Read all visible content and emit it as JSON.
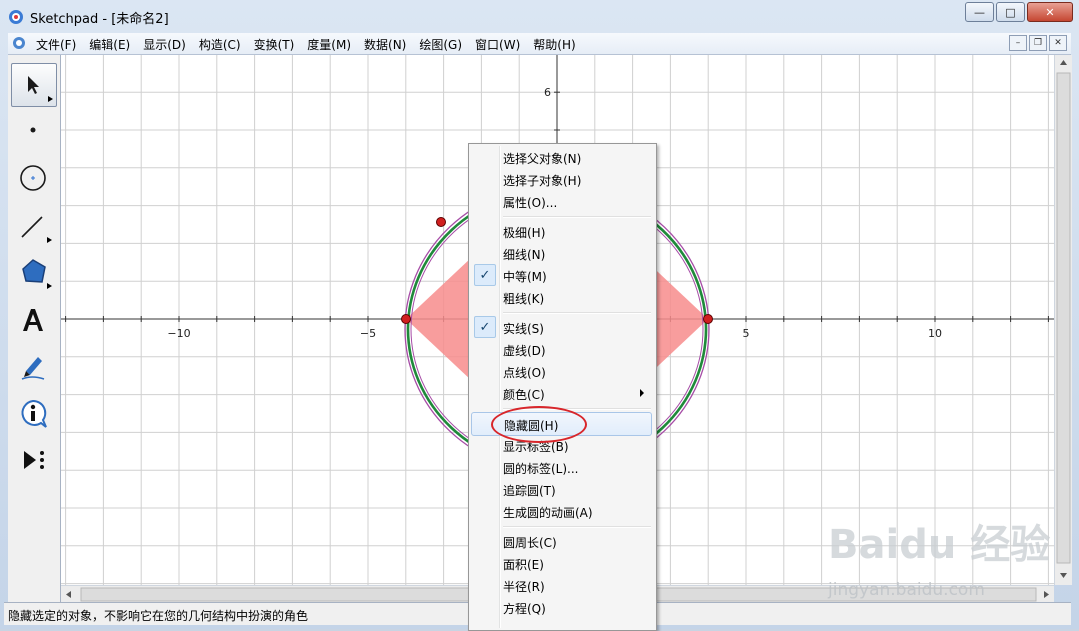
{
  "window": {
    "title": "Sketchpad - [未命名2]",
    "buttons": {
      "minimize": "—",
      "maximize": "□",
      "close": "✕"
    }
  },
  "menubar": {
    "items": [
      "文件(F)",
      "编辑(E)",
      "显示(D)",
      "构造(C)",
      "变换(T)",
      "度量(M)",
      "数据(N)",
      "绘图(G)",
      "窗口(W)",
      "帮助(H)"
    ]
  },
  "toolbar": {
    "tools": [
      "arrow-select-tool",
      "point-tool",
      "compass-tool",
      "straightedge-tool",
      "polygon-tool",
      "text-tool",
      "marker-tool",
      "information-tool",
      "custom-tool"
    ]
  },
  "canvas": {
    "axis_labels": {
      "x_neg10": "−10",
      "x_neg5": "−5",
      "x_5": "5",
      "x_10": "10",
      "y_6": "6"
    },
    "colors": {
      "circle_green": "#1f8a3a",
      "circle_purple": "#a64ca6",
      "shape_fill": "#f78c8c",
      "point_red": "#d11f1f",
      "grid": "#d0d0d0"
    }
  },
  "context_menu": {
    "group1": [
      "选择父对象(N)",
      "选择子对象(H)",
      "属性(O)..."
    ],
    "group2": [
      "极细(H)",
      "细线(N)",
      "中等(M)",
      "粗线(K)"
    ],
    "group3": [
      "实线(S)",
      "虚线(D)",
      "点线(O)",
      "颜色(C)"
    ],
    "group4": [
      "隐藏圆(H)",
      "显示标签(B)",
      "圆的标签(L)...",
      "追踪圆(T)",
      "生成圆的动画(A)"
    ],
    "group5": [
      "圆周长(C)",
      "面积(E)",
      "半径(R)",
      "方程(Q)"
    ]
  },
  "status_bar": {
    "text": "隐藏选定的对象，不影响它在您的几何结构中扮演的角色"
  },
  "watermark": {
    "line1": "Baidu 经验",
    "line2": "jingyan.baidu.com"
  }
}
